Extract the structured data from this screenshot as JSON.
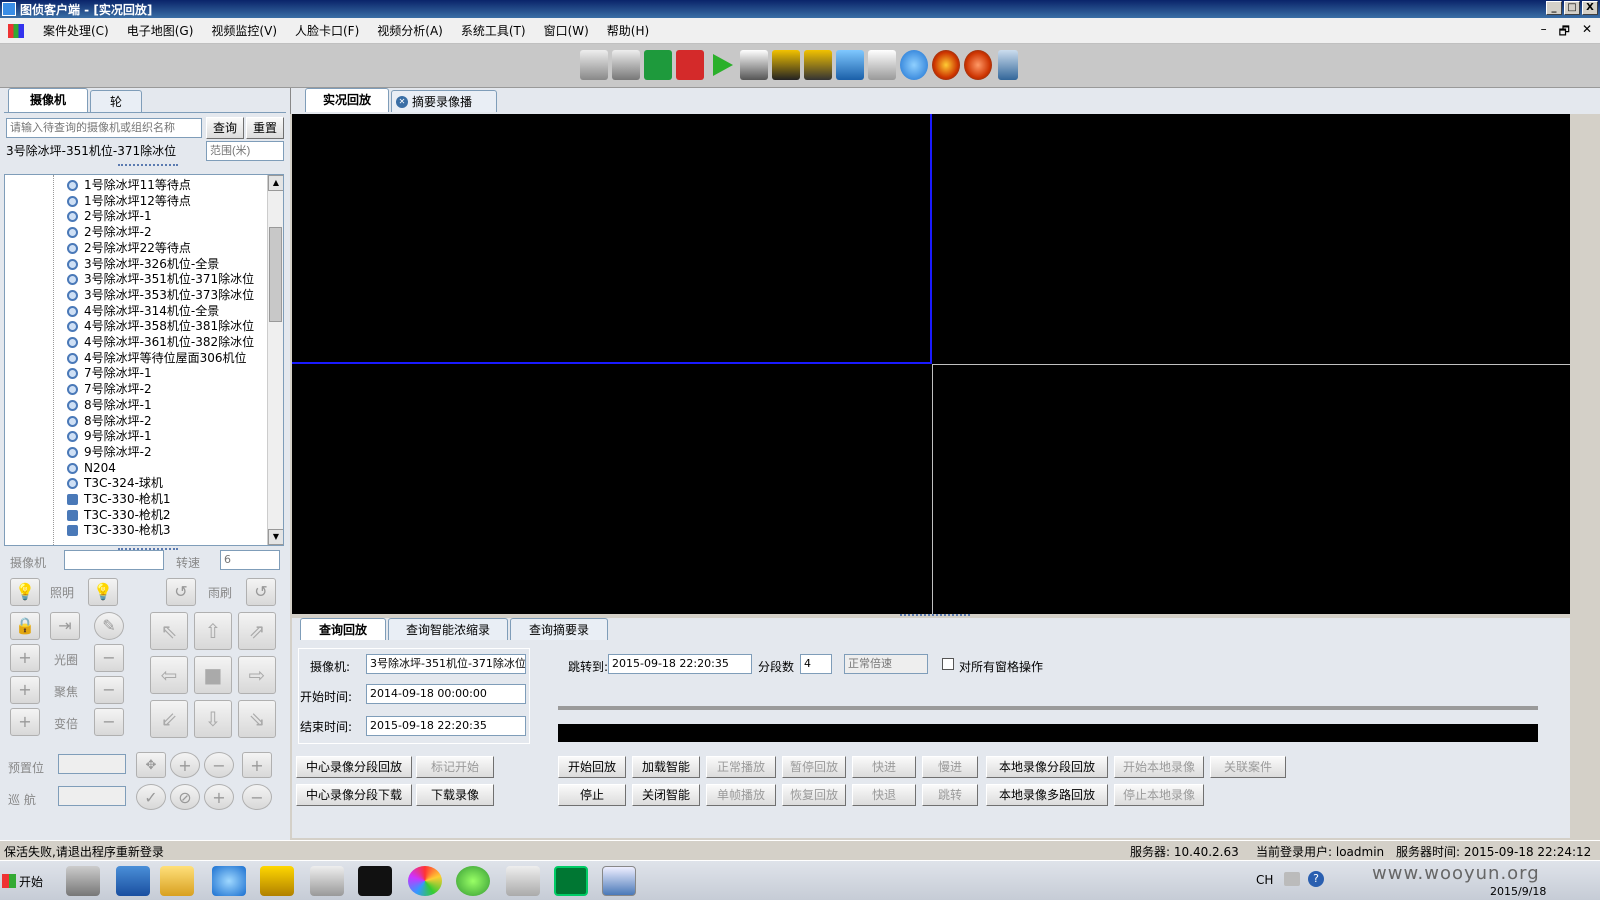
{
  "window": {
    "title": "图侦客户端 - [实况回放]",
    "btn_min": "_",
    "btn_max": "□",
    "btn_close": "X"
  },
  "menu": {
    "items": [
      "案件处理(C)",
      "电子地图(G)",
      "视频监控(V)",
      "人脸卡口(F)",
      "视频分析(A)",
      "系统工具(T)",
      "窗口(W)",
      "帮助(H)"
    ],
    "mdi_min": "–",
    "mdi_restore": "🗗",
    "mdi_close": "✕"
  },
  "toolbar": {
    "icons": [
      "camera-capture-icon",
      "camera-record-icon",
      "mic-on-icon",
      "mic-off-icon",
      "play-icon",
      "operator-icon",
      "save-icon",
      "disk-icon",
      "monitor-icon",
      "network-icon",
      "refresh-icon",
      "media-player-icon",
      "disc-icon",
      "phone-icon"
    ]
  },
  "left": {
    "tabs": [
      "摄像机",
      "轮切"
    ],
    "search_placeholder": "请输入待查询的摄像机或组织名称",
    "query_btn": "查询",
    "reset_btn": "重置",
    "selected_camera": "3号除冰坪-351机位-371除冰位",
    "range_placeholder": "范围(米)",
    "tree": [
      {
        "label": "1号除冰坪11等待点",
        "type": "dome"
      },
      {
        "label": "1号除冰坪12等待点",
        "type": "dome"
      },
      {
        "label": "2号除冰坪-1",
        "type": "dome"
      },
      {
        "label": "2号除冰坪-2",
        "type": "dome"
      },
      {
        "label": "2号除冰坪22等待点",
        "type": "dome"
      },
      {
        "label": "3号除冰坪-326机位-全景",
        "type": "dome"
      },
      {
        "label": "3号除冰坪-351机位-371除冰位",
        "type": "dome"
      },
      {
        "label": "3号除冰坪-353机位-373除冰位",
        "type": "dome"
      },
      {
        "label": "4号除冰坪-314机位-全景",
        "type": "dome"
      },
      {
        "label": "4号除冰坪-358机位-381除冰位",
        "type": "dome"
      },
      {
        "label": "4号除冰坪-361机位-382除冰位",
        "type": "dome"
      },
      {
        "label": "4号除冰坪等待位屋面306机位",
        "type": "dome"
      },
      {
        "label": "7号除冰坪-1",
        "type": "dome"
      },
      {
        "label": "7号除冰坪-2",
        "type": "dome"
      },
      {
        "label": "8号除冰坪-1",
        "type": "dome"
      },
      {
        "label": "8号除冰坪-2",
        "type": "dome"
      },
      {
        "label": "9号除冰坪-1",
        "type": "dome"
      },
      {
        "label": "9号除冰坪-2",
        "type": "dome"
      },
      {
        "label": "N204",
        "type": "dome"
      },
      {
        "label": "T3C-324-球机",
        "type": "dome"
      },
      {
        "label": "T3C-330-枪机1",
        "type": "gun"
      },
      {
        "label": "T3C-330-枪机2",
        "type": "gun"
      },
      {
        "label": "T3C-330-枪机3",
        "type": "gun"
      }
    ],
    "ptz": {
      "camera_label": "摄像机",
      "speed_label": "转速",
      "speed_value": "6",
      "light_label": "照明",
      "wiper_label": "雨刷",
      "iris_label": "光圈",
      "focus_label": "聚焦",
      "zoom_label": "变倍",
      "preset_label": "预置位",
      "cruise_label": "巡  航",
      "plus": "+",
      "minus": "−",
      "dir_up_left": "⇖",
      "dir_up": "⇧",
      "dir_up_right": "⇗",
      "dir_left": "⇦",
      "dir_stop": "■",
      "dir_right": "⇨",
      "dir_down_left": "⇙",
      "dir_down": "⇩",
      "dir_down_right": "⇘"
    }
  },
  "main": {
    "tabs": [
      "实况回放",
      "摘要录像播放"
    ],
    "close_tab": "✕",
    "query_tabs": [
      "查询回放",
      "查询智能浓缩录像",
      "查询摘要录像"
    ],
    "camera_label": "摄像机:",
    "camera_value": "3号除冰坪-351机位-371除冰位",
    "start_label": "开始时间:",
    "start_value": "2014-09-18 00:00:00",
    "end_label": "结束时间:",
    "end_value": "2015-09-18 22:20:35",
    "jump_label": "跳转到:",
    "jump_value": "2015-09-18 22:20:35",
    "segments_label": "分段数",
    "segments_value": "4",
    "speed_value": "正常倍速",
    "all_windows_label": "对所有窗格操作",
    "btn_center_seg_play": "中心录像分段回放",
    "btn_mark_start": "标记开始",
    "btn_center_seg_download": "中心录像分段下载",
    "btn_download": "下载录像",
    "btn_start_play": "开始回放",
    "btn_load_smart": "加载智能",
    "btn_normal_play": "正常播放",
    "btn_pause": "暂停回放",
    "btn_fast_fwd": "快进",
    "btn_slow": "慢进",
    "btn_local_seg_play": "本地录像分段回放",
    "btn_start_local_rec": "开始本地录像",
    "btn_link_case": "关联案件",
    "btn_stop": "停止",
    "btn_close_smart": "关闭智能",
    "btn_frame_play": "单帧播放",
    "btn_resume": "恢复回放",
    "btn_fast_back": "快退",
    "btn_jump": "跳转",
    "btn_local_multi_play": "本地录像多路回放",
    "btn_stop_local_rec": "停止本地录像"
  },
  "status": {
    "message": "保活失败,请退出程序重新登录",
    "server": "服务器: 10.40.2.63",
    "user": "当前登录用户: loadmin",
    "server_time": "服务器时间: 2015-09-18 22:24:12"
  },
  "taskbar": {
    "start": "开始",
    "lang": "CH",
    "date": "2015/9/18",
    "watermark": "www.wooyun.org",
    "apps": [
      "server-manager-icon",
      "powershell-icon",
      "explorer-icon",
      "ie-icon",
      "tool-icon",
      "search-icon",
      "cmd-icon",
      "color-app-icon",
      "green-app-icon",
      "window-app-icon",
      "kb-app-icon",
      "shield-app-icon"
    ]
  },
  "colors": {
    "title_bar": "#0a246a",
    "video_bg": "#000000",
    "selected_pane_border": "#1a1aff",
    "pane_border": "#c0c0c0"
  }
}
